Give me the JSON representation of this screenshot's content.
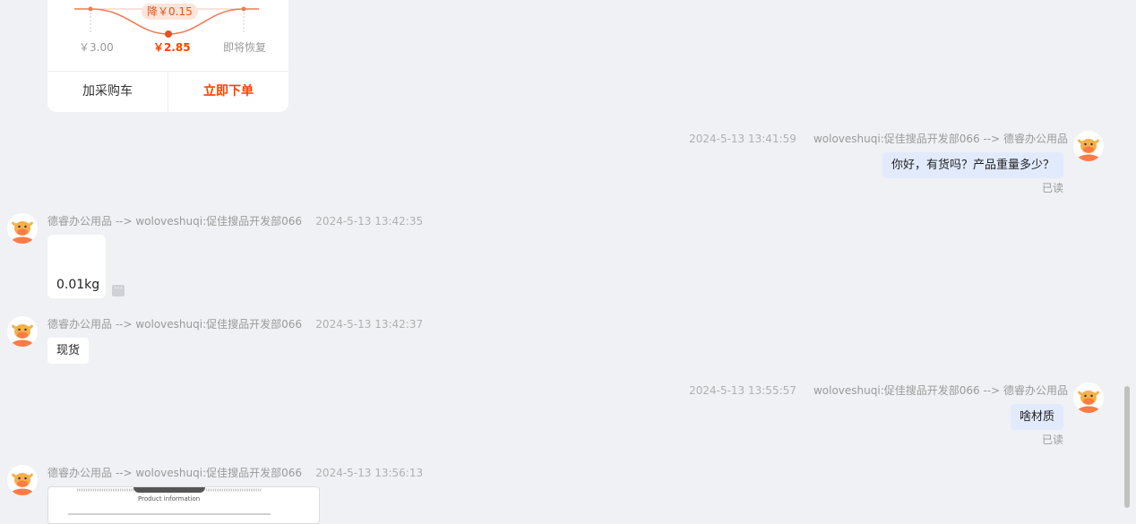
{
  "product_card": {
    "original_price": "￥3.00",
    "current_price": "￥2.85",
    "restore_label": "即将恢复",
    "discount_badge": "降￥0.15",
    "add_cart_label": "加采购车",
    "buy_now_label": "立即下单"
  },
  "messages": [
    {
      "direction": "out",
      "time": "2024-5-13 13:41:59",
      "route": "woloveshuqi:促佳搜品开发部066 --> 德睿办公用品",
      "text": "你好，有货吗？产品重量多少？",
      "status": "已读"
    },
    {
      "direction": "in",
      "route": "德睿办公用品 --> woloveshuqi:促佳搜品开发部066",
      "time": "2024-5-13 13:42:35",
      "text": "0.01kg",
      "more_icon": "ellipsis-icon"
    },
    {
      "direction": "in",
      "route": "德睿办公用品 --> woloveshuqi:促佳搜品开发部066",
      "time": "2024-5-13 13:42:37",
      "text": "现货"
    },
    {
      "direction": "out",
      "time": "2024-5-13 13:55:57",
      "route": "woloveshuqi:促佳搜品开发部066 --> 德睿办公用品",
      "text": "啥材质",
      "status": "已读"
    },
    {
      "direction": "in",
      "route": "德睿办公用品 --> woloveshuqi:促佳搜品开发部066",
      "time": "2024-5-13 13:56:13",
      "image_caption": "Product information"
    }
  ],
  "colors": {
    "accent": "#ff4000",
    "out_bubble": "#e2ebfd",
    "page_bg": "#f0f1f5"
  }
}
